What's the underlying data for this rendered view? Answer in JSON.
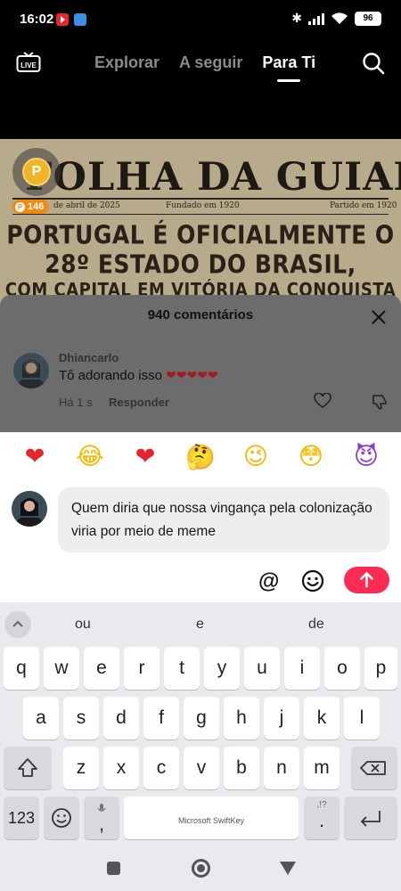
{
  "status_bar": {
    "time": "16:02",
    "battery": "96"
  },
  "top_nav": {
    "live_label": "LIVE",
    "tabs": [
      {
        "label": "Explorar",
        "active": false
      },
      {
        "label": "A seguir",
        "active": false
      },
      {
        "label": "Para Ti",
        "active": true
      }
    ]
  },
  "video": {
    "coin_count": "146",
    "coin_symbol": "P",
    "newspaper": {
      "name": "FOLHA DA GUIANA",
      "date": "de abril de 2025",
      "founded": "Fundado em 1920",
      "party": "Partido em 1920",
      "headline_1": "PORTUGAL É OFICIALMENTE O",
      "headline_2": "28º ESTADO DO BRASIL,",
      "headline_3": "COM CAPITAL EM VITÓRIA DA CONQUISTA"
    }
  },
  "comments": {
    "title": "940 comentários",
    "items": [
      {
        "user": "Dhiancarlo",
        "text": "Tô adorando isso",
        "hearts": "❤❤❤❤❤",
        "time": "Há 1 s",
        "reply_label": "Responder"
      }
    ]
  },
  "composer": {
    "quick_emojis": [
      "❤",
      "😂",
      "❤",
      "🤔",
      "😉",
      "😳",
      "😈"
    ],
    "emoji_colors": [
      "#e3262d",
      "#f5b800",
      "#e3262d",
      "#f5b800",
      "#f5b800",
      "#f5b800",
      "#8b3fd1"
    ],
    "input_text": "Quem diria que nossa vingança pela colonização viria por meio de meme",
    "at_label": "@",
    "accent_color": "#fe2c55"
  },
  "keyboard": {
    "suggestions": [
      "ou",
      "e",
      "de"
    ],
    "row1": [
      "q",
      "w",
      "e",
      "r",
      "t",
      "y",
      "u",
      "i",
      "o",
      "p"
    ],
    "row2": [
      "a",
      "s",
      "d",
      "f",
      "g",
      "h",
      "j",
      "k",
      "l"
    ],
    "row3": [
      "z",
      "x",
      "c",
      "v",
      "b",
      "n",
      "m"
    ],
    "numbers_label": "123",
    "comma_label": ",",
    "period_label": ".",
    "period_hint": ",!?",
    "space_label": "Microsoft SwiftKey"
  }
}
